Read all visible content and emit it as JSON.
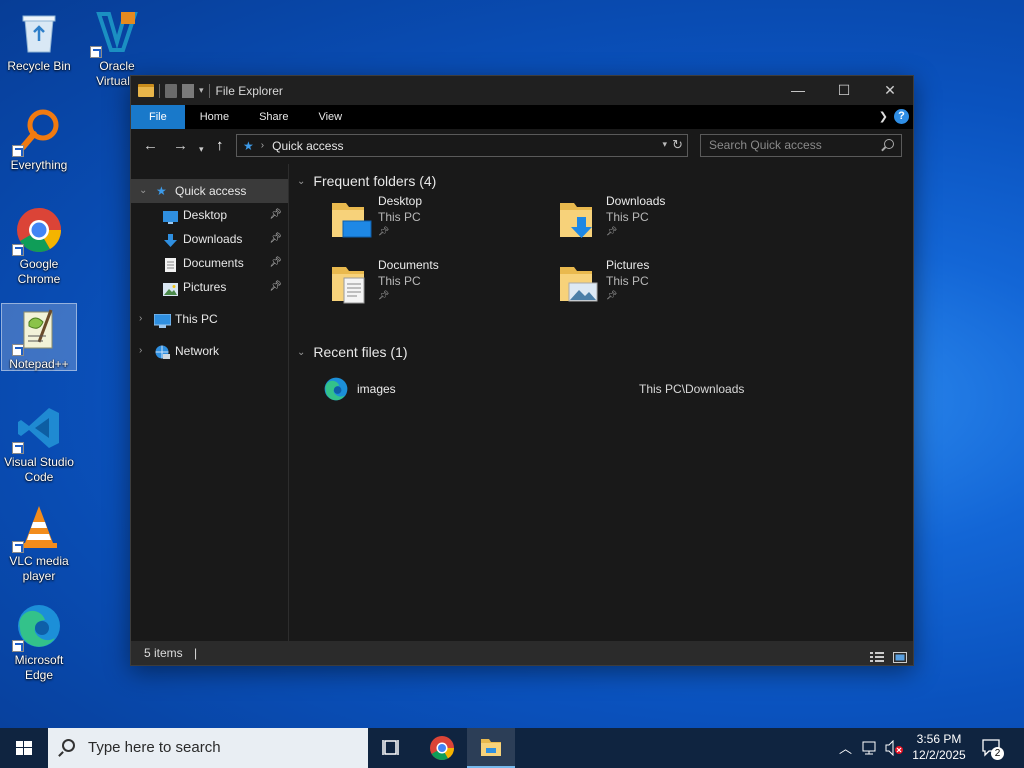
{
  "desktop": {
    "icons": [
      {
        "label": "Recycle Bin",
        "icon": "recycle-bin-icon"
      },
      {
        "label": "Oracle VirtualB",
        "icon": "virtualbox-icon"
      },
      {
        "label": "Everything",
        "icon": "everything-search-icon"
      },
      {
        "label": "Google Chrome",
        "icon": "chrome-icon"
      },
      {
        "label": "Notepad++",
        "icon": "notepadpp-icon"
      },
      {
        "label": "Visual Studio Code",
        "icon": "vscode-icon"
      },
      {
        "label": "VLC media player",
        "icon": "vlc-icon"
      },
      {
        "label": "Microsoft Edge",
        "icon": "edge-icon"
      }
    ]
  },
  "explorer": {
    "title": "File Explorer",
    "ribbon": {
      "tabs": [
        "File",
        "Home",
        "Share",
        "View"
      ],
      "help": "?"
    },
    "address": {
      "path": "Quick access"
    },
    "search": {
      "placeholder": "Search Quick access"
    },
    "nav": {
      "items": [
        {
          "label": "Quick access",
          "icon": "star-icon"
        },
        {
          "label": "Desktop",
          "icon": "desktop-icon",
          "pinned": true
        },
        {
          "label": "Downloads",
          "icon": "download-arrow-icon",
          "pinned": true
        },
        {
          "label": "Documents",
          "icon": "document-icon",
          "pinned": true
        },
        {
          "label": "Pictures",
          "icon": "pictures-icon",
          "pinned": true
        },
        {
          "label": "This PC",
          "icon": "computer-icon"
        },
        {
          "label": "Network",
          "icon": "network-icon"
        }
      ]
    },
    "frequent": {
      "header": "Frequent folders (4)",
      "folders": [
        {
          "name": "Desktop",
          "location": "This PC"
        },
        {
          "name": "Downloads",
          "location": "This PC"
        },
        {
          "name": "Documents",
          "location": "This PC"
        },
        {
          "name": "Pictures",
          "location": "This PC"
        }
      ]
    },
    "recent": {
      "header": "Recent files (1)",
      "files": [
        {
          "name": "images",
          "location": "This PC\\Downloads",
          "icon": "edge-icon"
        }
      ]
    },
    "status": {
      "items": "5 items",
      "cursor": "|"
    }
  },
  "taskbar": {
    "search_placeholder": "Type here to search",
    "time": "3:56 PM",
    "date": "12/2/2025",
    "notification_count": "2"
  },
  "colors": {
    "accent": "#1979ca",
    "window_bg": "#191919",
    "taskbar": "#0f2440"
  }
}
